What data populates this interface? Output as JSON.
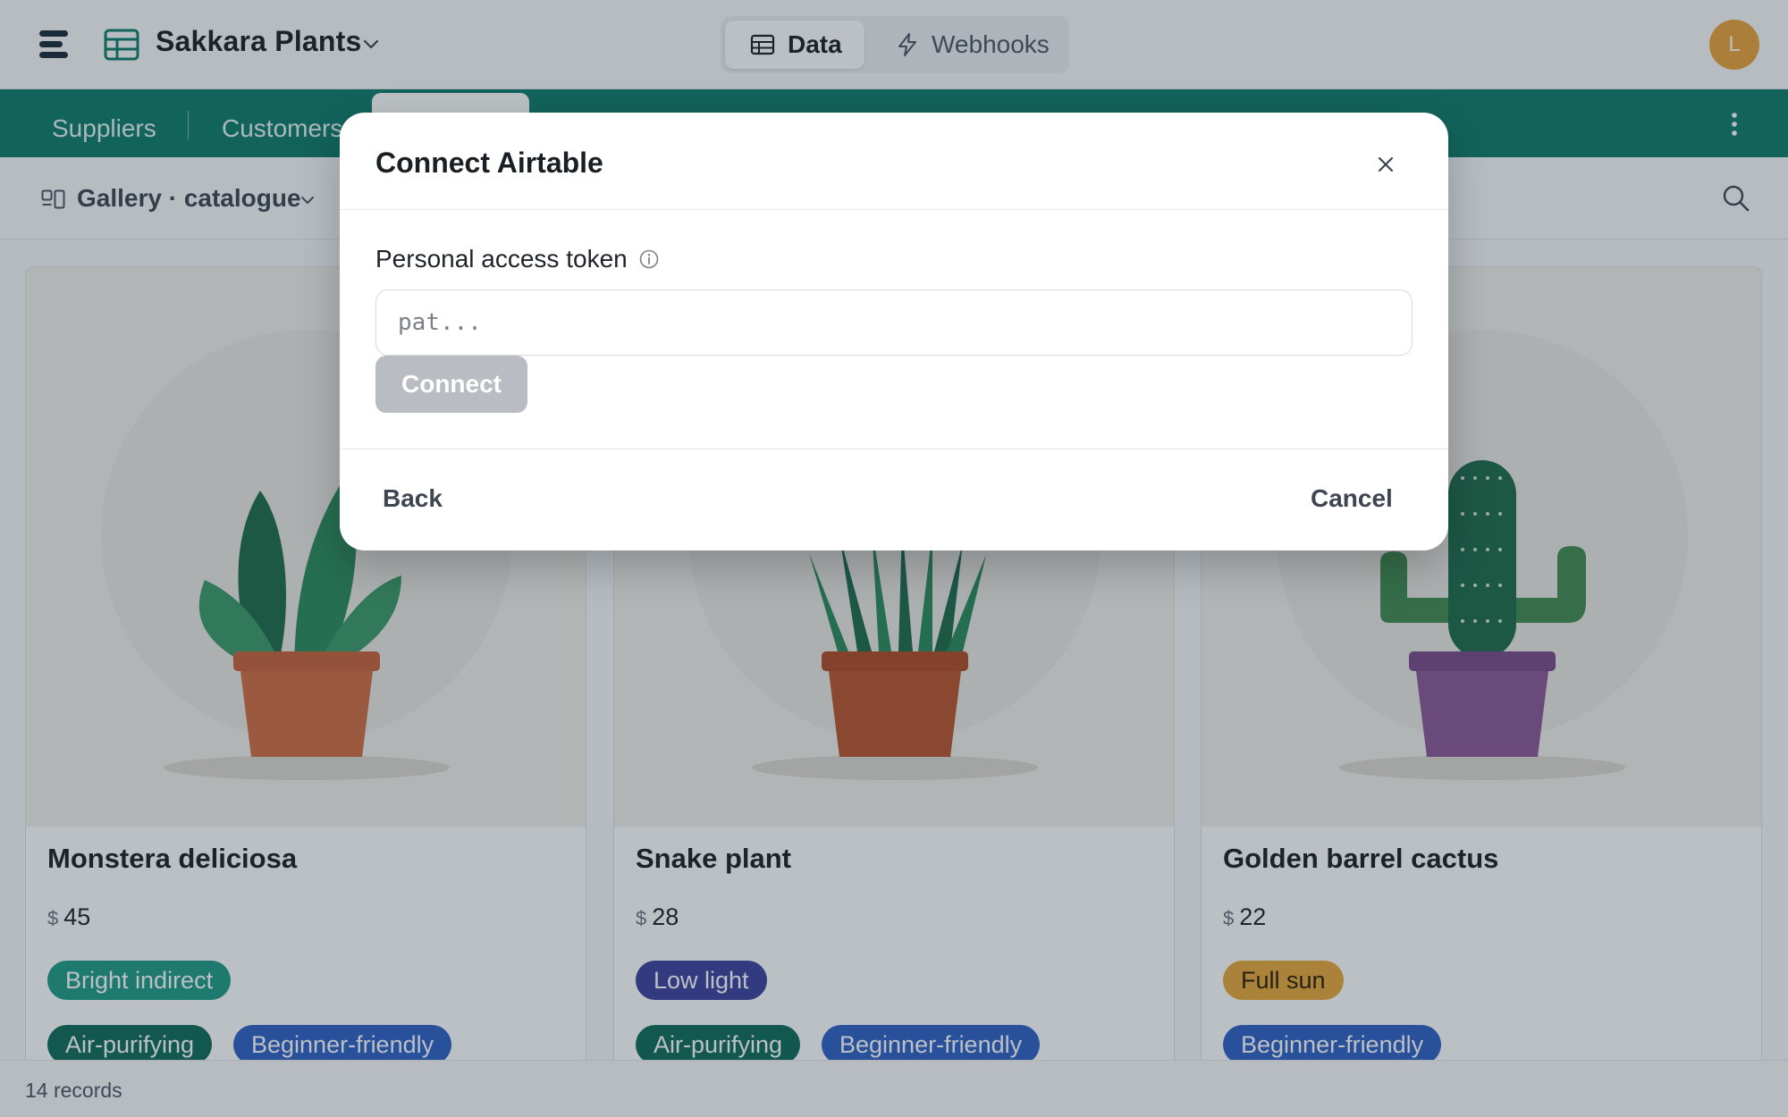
{
  "header": {
    "app_name": "Sakkara Plants",
    "logo_icon": "stack-logo-icon",
    "app_icon": "table-icon",
    "avatar_initial": "L",
    "avatar_color": "#e8a13a",
    "view_switch": [
      {
        "label": "Data",
        "icon": "table-icon",
        "active": true
      },
      {
        "label": "Webhooks",
        "icon": "lightning-icon",
        "active": false
      }
    ]
  },
  "tabs": {
    "items": [
      "Suppliers",
      "Customers"
    ],
    "accent": "#0e7a6a"
  },
  "view": {
    "name": "Gallery · catalogue"
  },
  "gallery": {
    "cards": [
      {
        "title": "Monstera deliciosa",
        "currency": "$",
        "price": "45",
        "light": {
          "label": "Bright indirect",
          "color": "#1f9a85"
        },
        "tags": [
          {
            "label": "Air-purifying",
            "color": "#0f6b58"
          },
          {
            "label": "Beginner-friendly",
            "color": "#2f5fc4"
          }
        ]
      },
      {
        "title": "Snake plant",
        "currency": "$",
        "price": "28",
        "light": {
          "label": "Low light",
          "color": "#3b3f9e"
        },
        "tags": [
          {
            "label": "Air-purifying",
            "color": "#0f6b58"
          },
          {
            "label": "Beginner-friendly",
            "color": "#2f5fc4"
          }
        ]
      },
      {
        "title": "Golden barrel cactus",
        "currency": "$",
        "price": "22",
        "light": {
          "label": "Full sun",
          "color": "#e8a73a"
        },
        "tags": [
          {
            "label": "Beginner-friendly",
            "color": "#2f5fc4"
          }
        ]
      }
    ]
  },
  "status": {
    "records": "14 records"
  },
  "modal": {
    "title": "Connect Airtable",
    "token_label": "Personal access token",
    "token_placeholder": "pat...",
    "token_value": "",
    "connect_label": "Connect",
    "back_label": "Back",
    "cancel_label": "Cancel"
  }
}
